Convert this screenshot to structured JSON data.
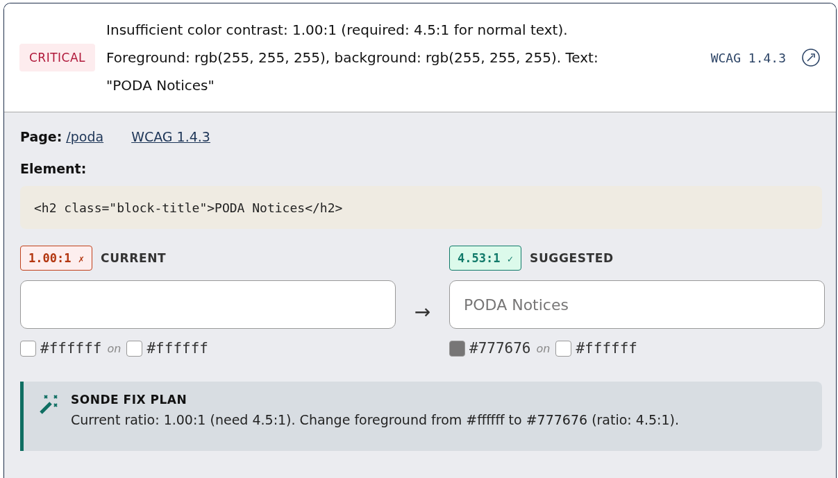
{
  "header": {
    "severity": "CRITICAL",
    "message_lines": [
      "Insufficient color contrast: 1.00:1 (required: 4.5:1 for normal text).",
      "Foreground: rgb(255, 255, 255), background: rgb(255, 255, 255). Text:",
      "\"PODA Notices\""
    ],
    "rule": "WCAG 1.4.3"
  },
  "page": {
    "label": "Page:",
    "path": "/poda",
    "rule_link": "WCAG 1.4.3"
  },
  "element": {
    "label": "Element:",
    "code": "<h2 class=\"block-title\">PODA Notices</h2>"
  },
  "arrow": "→",
  "samples": [
    {
      "ratio": "1.00:1",
      "mark": "✗",
      "passed": false,
      "label": "CURRENT",
      "swatches": [
        {
          "hex": "#ffffff"
        },
        {
          "hex": "#ffffff"
        }
      ],
      "joiner": "on"
    },
    {
      "ratio": "4.53:1",
      "mark": "✓",
      "passed": true,
      "label": "SUGGESTED",
      "preview_text": "PODA Notices",
      "swatches": [
        {
          "hex": "#777676"
        },
        {
          "hex": "#ffffff"
        }
      ],
      "joiner": "on"
    }
  ],
  "fix_plan": {
    "title": "SONDE FIX PLAN",
    "text": "Current ratio: 1.00:1 (need 4.5:1). Change foreground from #ffffff to #777676 (ratio: 4.5:1)."
  }
}
